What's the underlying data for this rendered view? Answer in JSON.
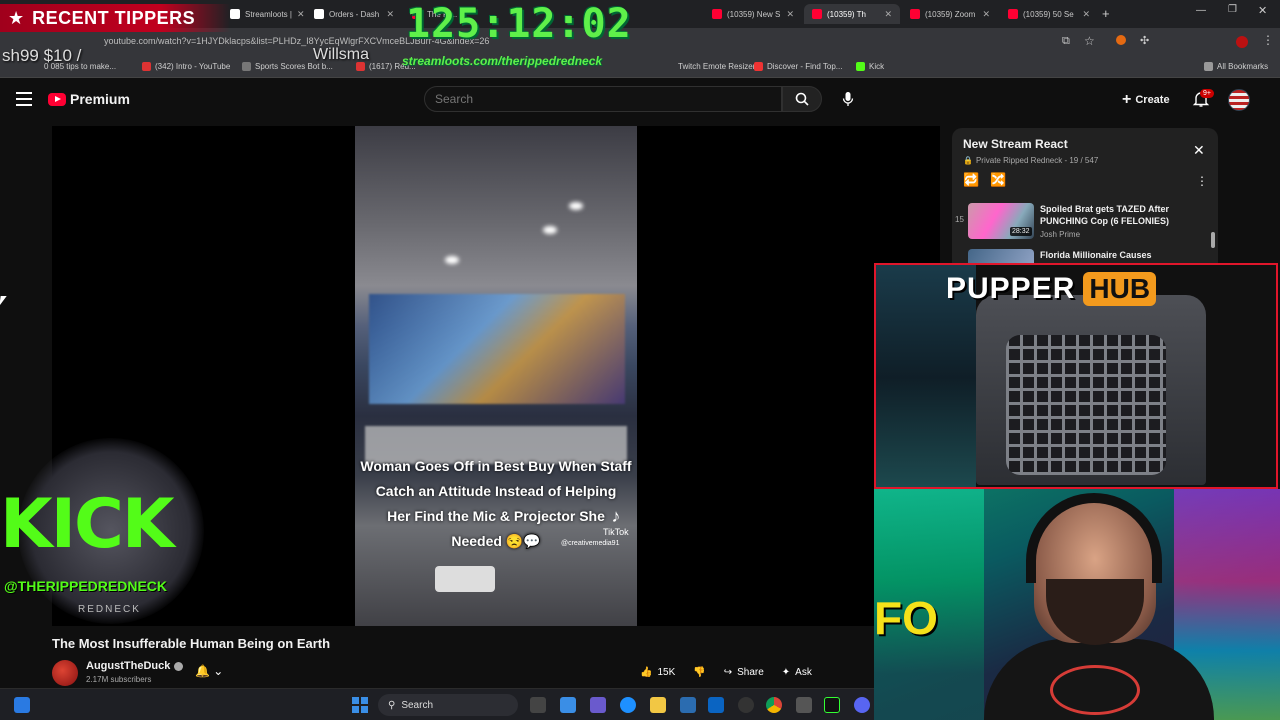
{
  "browser": {
    "tabs": [
      {
        "label": "Streamloots | "
      },
      {
        "label": "Orders - Dash"
      },
      {
        "label": "The Ri..."
      },
      {
        "label": "(10359) New S"
      },
      {
        "label": "(10359) Th"
      },
      {
        "label": "(10359) Zoom"
      },
      {
        "label": "(10359) 50 Se"
      }
    ],
    "url": "youtube.com/watch?v=1HJYDklacps&list=PLHDz_I8YycEqWlgrFXCVmceBLJBurr-4G&index=26",
    "bookmarks": [
      {
        "label": "0 085 tips to make..."
      },
      {
        "label": "(342) Intro - YouTube"
      },
      {
        "label": "Sports Scores Bot b..."
      },
      {
        "label": "(1617) Red..."
      },
      {
        "label": "Twitch Emote Resizer"
      },
      {
        "label": "Discover - Find Top..."
      },
      {
        "label": "Kick"
      }
    ],
    "all_bookmarks": "All Bookmarks"
  },
  "youtube": {
    "logo_text": "Premium",
    "search_placeholder": "Search",
    "create_label": "Create",
    "notif_count": "9+"
  },
  "video": {
    "caption_lines": [
      "Woman Goes Off in Best Buy When Staff",
      "Catch an Attitude Instead of Helping",
      "Her Find the Mic & Projector She",
      "Needed 😒💬"
    ],
    "tiktok_label": "TikTok",
    "tiktok_handle": "@creativemedia91",
    "title": "The Most Insufferable Human Being on Earth",
    "channel": "AugustTheDuck",
    "subscribers": "2.17M subscribers",
    "likes": "15K",
    "share_label": "Share",
    "ask_label": "Ask"
  },
  "playlist": {
    "title": "New Stream React",
    "subtitle": "Private Ripped Redneck - 19 / 547",
    "items": [
      {
        "num": "15",
        "title": "Spoiled Brat gets TAZED After PUNCHING Cop (6 FELONIES)",
        "duration": "28:32",
        "channel": "Josh Prime"
      },
      {
        "num": "",
        "title": "Florida Millionaire Causes",
        "duration": "",
        "channel": ""
      }
    ]
  },
  "overlay": {
    "recent_tippers_label": "RECENT TIPPERS",
    "tipper_amount": "sh99 $10 /",
    "tipper_name": "Willsma",
    "timer": "125:12:02",
    "streamloots_url": "streamloots.com/therippedredneck",
    "kick_word": "KICK",
    "kick_handle": "@THERIPPEDREDNECK",
    "kick_sub": "REDNECK",
    "pupper_word": "PUPPER",
    "hub_word": "HUB",
    "sign_text": "FO"
  },
  "taskbar": {
    "search_label": "Search"
  }
}
